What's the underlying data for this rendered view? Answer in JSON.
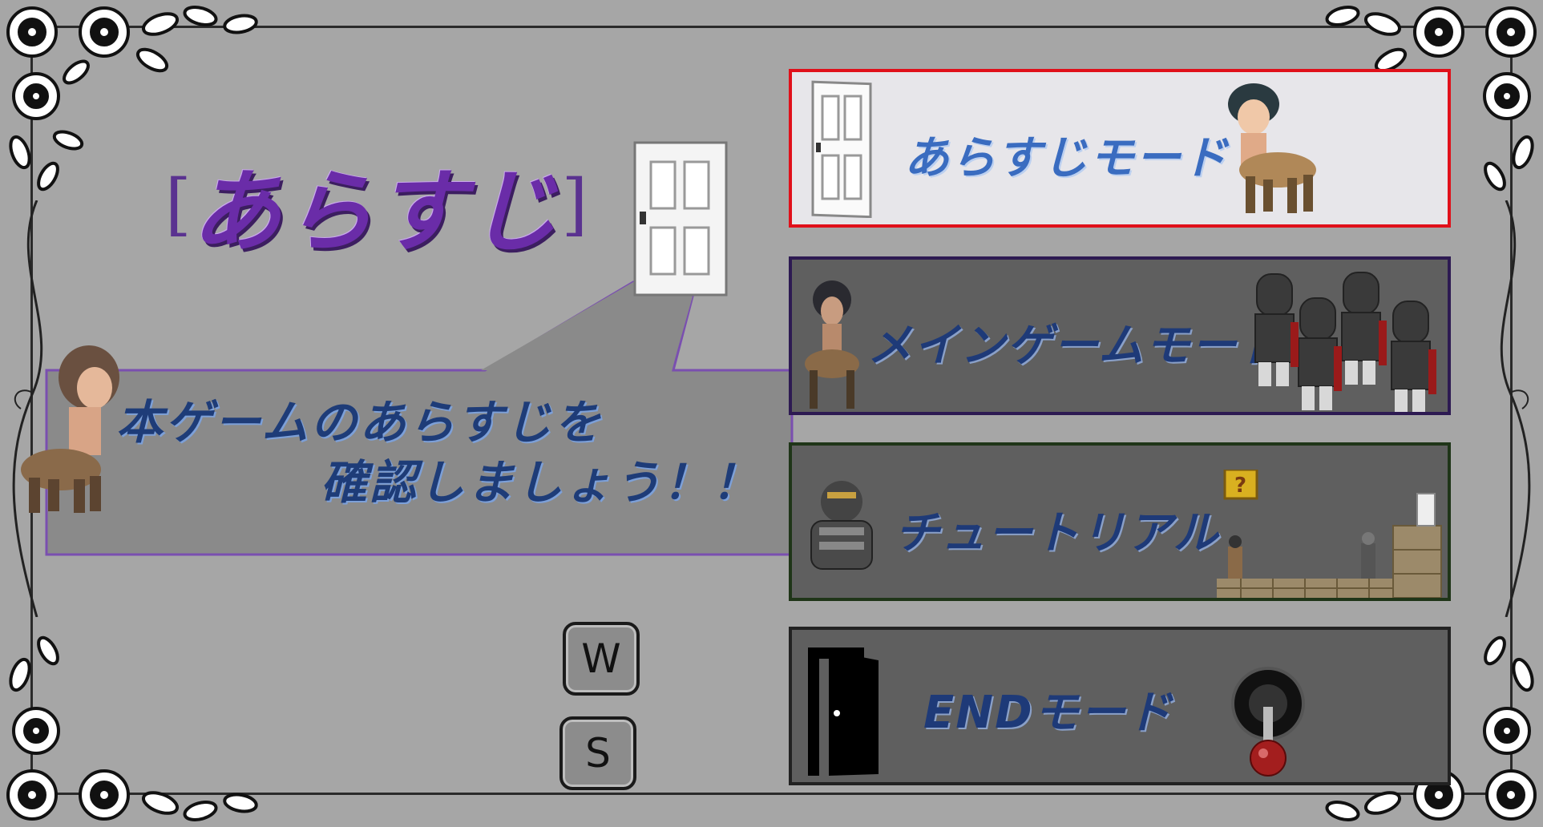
{
  "title": {
    "open_bracket": "[",
    "text": "あらすじ",
    "close_bracket": "]"
  },
  "description": {
    "line1": "本ゲームのあらすじを",
    "line2": "確認しましょう！！"
  },
  "keys": {
    "up": "W",
    "down": "S"
  },
  "menu": {
    "items": [
      {
        "label": "あらすじモード",
        "selected": true
      },
      {
        "label": "メインゲームモード",
        "selected": false
      },
      {
        "label": "チュートリアル",
        "selected": false
      },
      {
        "label": "ENDモード",
        "selected": false
      }
    ]
  },
  "colors": {
    "background": "#a6a6a6",
    "selected_border": "#e0101a",
    "title": "#6a2ca8",
    "label_active": "#3a6cc0",
    "label_inactive": "#1e3a78"
  },
  "icons": {
    "door": "door-icon",
    "exit_door": "exit-door-icon",
    "joystick": "joystick-icon",
    "centaur": "centaur-sprite",
    "knight": "knight-sprite",
    "question_block": "question-block-icon"
  }
}
